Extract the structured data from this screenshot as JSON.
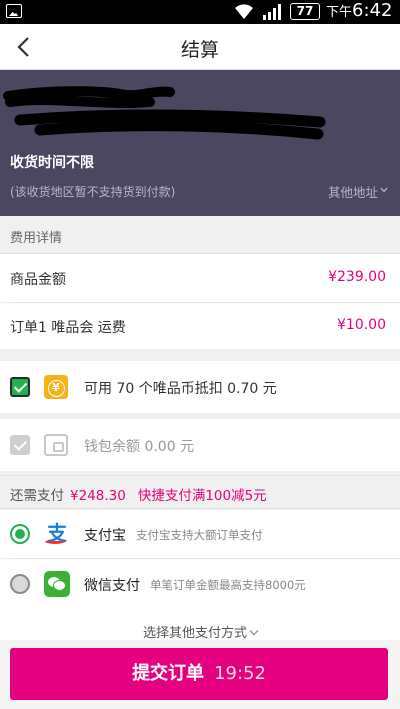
{
  "statusbar": {
    "battery": "77",
    "ampm": "下午",
    "time": "6:42"
  },
  "header": {
    "title": "结算"
  },
  "address": {
    "delivery_time": "收货时间不限",
    "note": "(该收货地区暂不支持货到付款)",
    "other_address": "其他地址"
  },
  "fees": {
    "section_title": "费用详情",
    "items": [
      {
        "label": "商品金额",
        "amount": "¥239.00"
      },
      {
        "label": "订单1 唯品会 运费",
        "amount": "¥10.00"
      }
    ]
  },
  "discounts": {
    "coins_label": "可用 70 个唯品币抵扣 0.70 元",
    "coins_checked": true,
    "wallet_label": "钱包余额 0.00 元",
    "wallet_checked": true,
    "wallet_disabled": true,
    "coin_icon_glyph": "¥"
  },
  "need_pay": {
    "label": "还需支付",
    "amount": "¥248.30",
    "promo": "快捷支付满100减5元"
  },
  "payment_methods": [
    {
      "name": "支付宝",
      "desc": "支付宝支持大额订单支付",
      "selected": true,
      "icon": "alipay-icon",
      "glyph": "支"
    },
    {
      "name": "微信支付",
      "desc": "单笔订单金额最高支持8000元",
      "selected": false,
      "icon": "wechat-icon"
    }
  ],
  "more_payment": "选择其他支付方式",
  "submit": {
    "label": "提交订单",
    "countdown": "19:52"
  },
  "colors": {
    "accent": "#e5007f",
    "address_bg": "#4b4760",
    "check_green": "#23b14d"
  }
}
